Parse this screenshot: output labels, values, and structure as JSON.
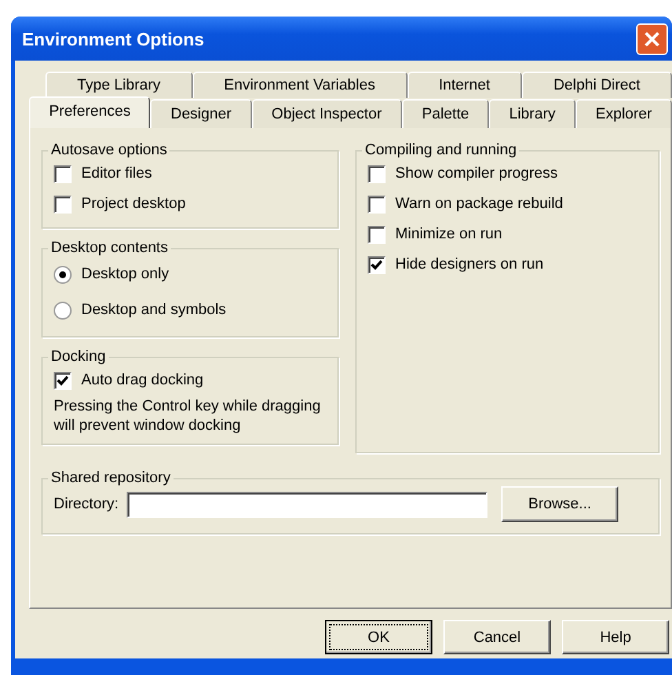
{
  "window": {
    "title": "Environment Options"
  },
  "tab_rows": [
    [
      {
        "label": "Type Library",
        "selected": false
      },
      {
        "label": "Environment Variables",
        "selected": false
      },
      {
        "label": "Internet",
        "selected": false
      },
      {
        "label": "Delphi Direct",
        "selected": false
      }
    ],
    [
      {
        "label": "Preferences",
        "selected": true
      },
      {
        "label": "Designer",
        "selected": false
      },
      {
        "label": "Object Inspector",
        "selected": false
      },
      {
        "label": "Palette",
        "selected": false
      },
      {
        "label": "Library",
        "selected": false
      },
      {
        "label": "Explorer",
        "selected": false
      }
    ]
  ],
  "left_groups": [
    {
      "title": "Autosave options",
      "items": [
        {
          "kind": "checkbox",
          "label": "Editor files",
          "checked": false
        },
        {
          "kind": "checkbox",
          "label": "Project desktop",
          "checked": false
        }
      ]
    },
    {
      "title": "Desktop contents",
      "items": [
        {
          "kind": "radio",
          "label": "Desktop only",
          "selected": true
        },
        {
          "kind": "radio",
          "label": "Desktop and symbols",
          "selected": false
        }
      ]
    },
    {
      "title": "Docking",
      "items": [
        {
          "kind": "checkbox",
          "label": "Auto drag docking",
          "checked": true
        },
        {
          "kind": "note",
          "label": "Pressing the Control key while dragging will prevent window docking"
        }
      ]
    }
  ],
  "right_group": {
    "title": "Compiling and running",
    "items": [
      {
        "kind": "checkbox",
        "label": "Show compiler progress",
        "checked": false
      },
      {
        "kind": "checkbox",
        "label": "Warn on package rebuild",
        "checked": false
      },
      {
        "kind": "checkbox",
        "label": "Minimize on run",
        "checked": false
      },
      {
        "kind": "checkbox",
        "label": "Hide designers on run",
        "checked": true
      }
    ]
  },
  "shared_repository": {
    "title": "Shared repository",
    "field_label": "Directory:",
    "button": "Browse..."
  },
  "buttons": [
    {
      "label": "OK",
      "focused": true
    },
    {
      "label": "Cancel",
      "focused": false
    },
    {
      "label": "Help",
      "focused": false
    }
  ]
}
